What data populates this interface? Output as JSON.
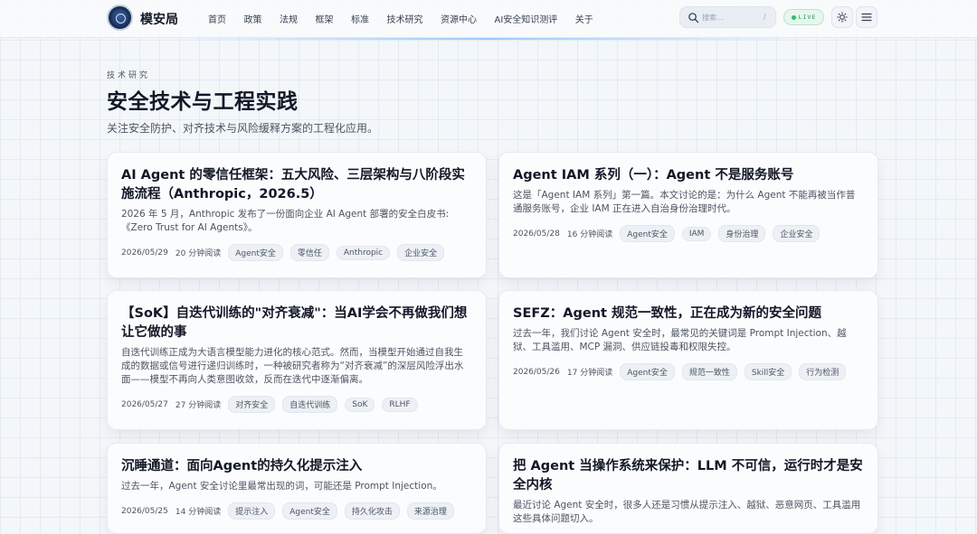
{
  "header": {
    "brand": "模安局",
    "nav": [
      "首页",
      "政策",
      "法规",
      "框架",
      "标准",
      "技术研究",
      "资源中心",
      "AI安全知识测评",
      "关于"
    ],
    "search_placeholder": "搜索...",
    "search_shortcut": "/",
    "live_label": "LIVE"
  },
  "icons": {
    "logo": "emblem-logo",
    "search": "search-icon",
    "theme": "sun-icon",
    "menu": "hamburger-menu-icon"
  },
  "colors": {
    "live_green": "#22c55e",
    "tag_bg": "#edf1f5",
    "title": "#111827"
  },
  "page": {
    "eyebrow": "技术研究",
    "title": "安全技术与工程实践",
    "description": "关注安全防护、对齐技术与风险缓释方案的工程化应用。"
  },
  "articles": [
    {
      "title": "AI Agent 的零信任框架：五大风险、三层架构与八阶段实施流程（Anthropic，2026.5）",
      "summary": "2026 年 5 月，Anthropic 发布了一份面向企业 AI Agent 部署的安全白皮书:《Zero Trust for AI Agents》。",
      "date": "2026/05/29",
      "read_time": "20 分钟阅读",
      "tags": [
        "Agent安全",
        "零信任",
        "Anthropic",
        "企业安全"
      ]
    },
    {
      "title": "Agent IAM 系列（一）：Agent 不是服务账号",
      "summary": "这是「Agent IAM 系列」第一篇。本文讨论的是：为什么 Agent 不能再被当作普通服务账号，企业 IAM 正在进入自治身份治理时代。",
      "date": "2026/05/28",
      "read_time": "16 分钟阅读",
      "tags": [
        "Agent安全",
        "IAM",
        "身份治理",
        "企业安全"
      ]
    },
    {
      "title": "【SoK】自迭代训练的\"对齐衰减\"：当AI学会不再做我们想让它做的事",
      "summary": "自迭代训练正成为大语言模型能力进化的核心范式。然而，当模型开始通过自我生成的数据或信号进行递归训练时，一种被研究者称为“对齐衰减”的深层风险浮出水面——模型不再向人类意图收敛，反而在迭代中逐渐偏离。",
      "date": "2026/05/27",
      "read_time": "27 分钟阅读",
      "tags": [
        "对齐安全",
        "自迭代训练",
        "SoK",
        "RLHF"
      ]
    },
    {
      "title": "SEFZ：Agent 规范一致性，正在成为新的安全问题",
      "summary": "过去一年，我们讨论 Agent 安全时，最常见的关键词是 Prompt Injection、越狱、工具滥用、MCP 漏洞、供应链投毒和权限失控。",
      "date": "2026/05/26",
      "read_time": "17 分钟阅读",
      "tags": [
        "Agent安全",
        "规范一致性",
        "Skill安全",
        "行为检测"
      ]
    },
    {
      "title": "沉睡通道：面向Agent的持久化提示注入",
      "summary": "过去一年，Agent 安全讨论里最常出现的词，可能还是 Prompt Injection。",
      "date": "2026/05/25",
      "read_time": "14 分钟阅读",
      "tags": [
        "提示注入",
        "Agent安全",
        "持久化攻击",
        "来源治理"
      ]
    },
    {
      "title": "把 Agent 当操作系统来保护：LLM 不可信，运行时才是安全内核",
      "summary": "最近讨论 Agent 安全时，很多人还是习惯从提示注入、越狱、恶意网页、工具滥用这些具体问题切入。",
      "date": "",
      "read_time": "",
      "tags": []
    }
  ]
}
